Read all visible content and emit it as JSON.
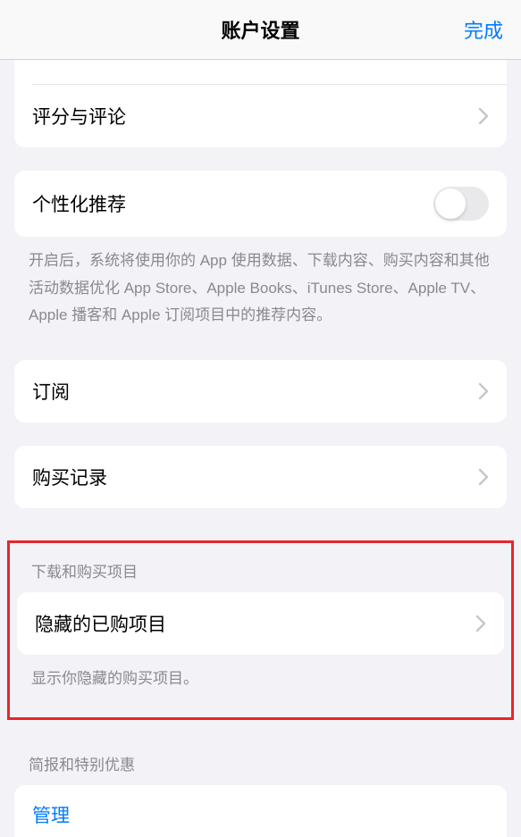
{
  "header": {
    "title": "账户设置",
    "done": "完成"
  },
  "ratings_reviews": {
    "label": "评分与评论"
  },
  "personalized": {
    "label": "个性化推荐",
    "footer": "开启后，系统将使用你的 App 使用数据、下载内容、购买内容和其他活动数据优化 App Store、Apple Books、iTunes Store、Apple TV、Apple 播客和 Apple 订阅项目中的推荐内容。"
  },
  "subscriptions": {
    "label": "订阅"
  },
  "purchase_history": {
    "label": "购买记录"
  },
  "downloads_section": {
    "header": "下载和购买项目",
    "hidden_purchases": "隐藏的已购项目",
    "footer": "显示你隐藏的购买项目。"
  },
  "newsletter_section": {
    "header": "简报和特别优惠",
    "manage": "管理"
  }
}
